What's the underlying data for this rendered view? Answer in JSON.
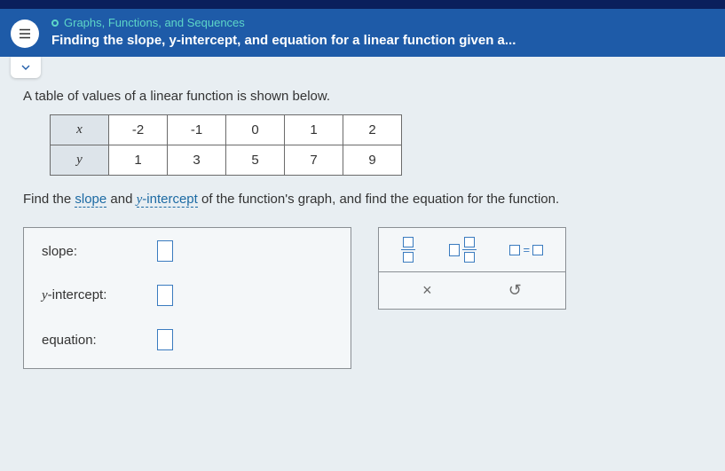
{
  "header": {
    "breadcrumb": "Graphs, Functions, and Sequences",
    "title": "Finding the slope, y-intercept, and equation for a linear function given a..."
  },
  "prompt": "A table of values of a linear function is shown below.",
  "table": {
    "row_x_label": "x",
    "row_y_label": "y",
    "x": [
      "-2",
      "-1",
      "0",
      "1",
      "2"
    ],
    "y": [
      "1",
      "3",
      "5",
      "7",
      "9"
    ]
  },
  "question_parts": {
    "p1": "Find the ",
    "slope": "slope",
    "p2": " and ",
    "yint_y": "y",
    "yint_rest": "-intercept",
    "p3": " of the function's graph, and find the equation for the function."
  },
  "answers": {
    "slope_label": "slope:",
    "yint_label": "y-intercept:",
    "eqn_label": "equation:"
  },
  "tools": {
    "clear": "×",
    "reset": "↺"
  },
  "chart_data": {
    "type": "table",
    "title": "Table of values of a linear function",
    "columns": [
      "x",
      "y"
    ],
    "rows": [
      {
        "x": -2,
        "y": 1
      },
      {
        "x": -1,
        "y": 3
      },
      {
        "x": 0,
        "y": 5
      },
      {
        "x": 1,
        "y": 7
      },
      {
        "x": 2,
        "y": 9
      }
    ]
  }
}
